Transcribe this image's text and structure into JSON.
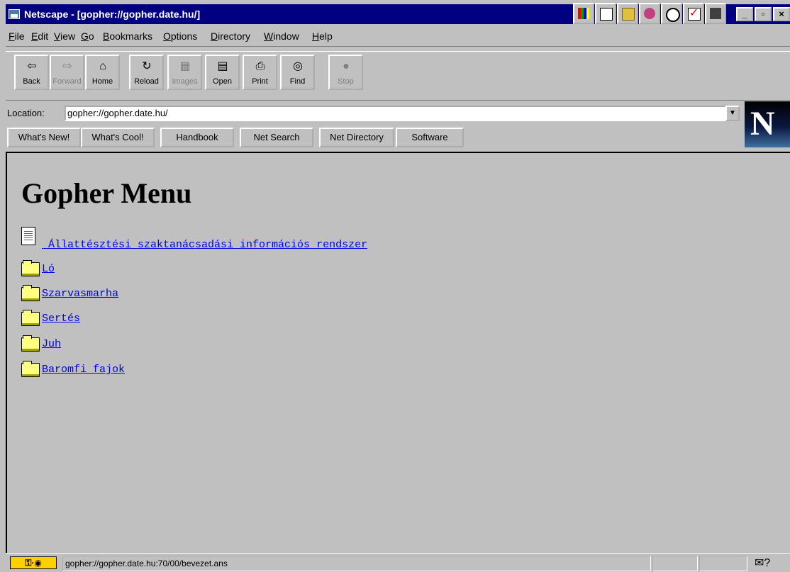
{
  "window": {
    "title": "Netscape - [gopher://gopher.date.hu/]"
  },
  "menu": [
    "File",
    "Edit",
    "View",
    "Go",
    "Bookmarks",
    "Options",
    "Directory",
    "Window",
    "Help"
  ],
  "toolbar": {
    "back": "Back",
    "forward": "Forward",
    "home": "Home",
    "reload": "Reload",
    "images": "Images",
    "open": "Open",
    "print": "Print",
    "find": "Find",
    "stop": "Stop"
  },
  "location": {
    "label": "Location:",
    "url": "gopher://gopher.date.hu/"
  },
  "directory_buttons": [
    "What's New!",
    "What's Cool!",
    "Handbook",
    "Net Search",
    "Net Directory",
    "Software"
  ],
  "page": {
    "title": "Gopher Menu",
    "items": [
      {
        "type": "document",
        "label": " Állattésztési szaktanácsadási információs rendszer"
      },
      {
        "type": "folder",
        "label": "Ló"
      },
      {
        "type": "folder",
        "label": "Szarvasmarha"
      },
      {
        "type": "folder",
        "label": "Sertés"
      },
      {
        "type": "folder",
        "label": "Juh"
      },
      {
        "type": "folder",
        "label": "Baromfi fajok"
      }
    ]
  },
  "status": {
    "text": "gopher://gopher.date.hu:70/00/bevezet.ans"
  },
  "colors": {
    "titlebar": "#000080",
    "chrome": "#c0c0c0",
    "link": "#0000ee"
  }
}
